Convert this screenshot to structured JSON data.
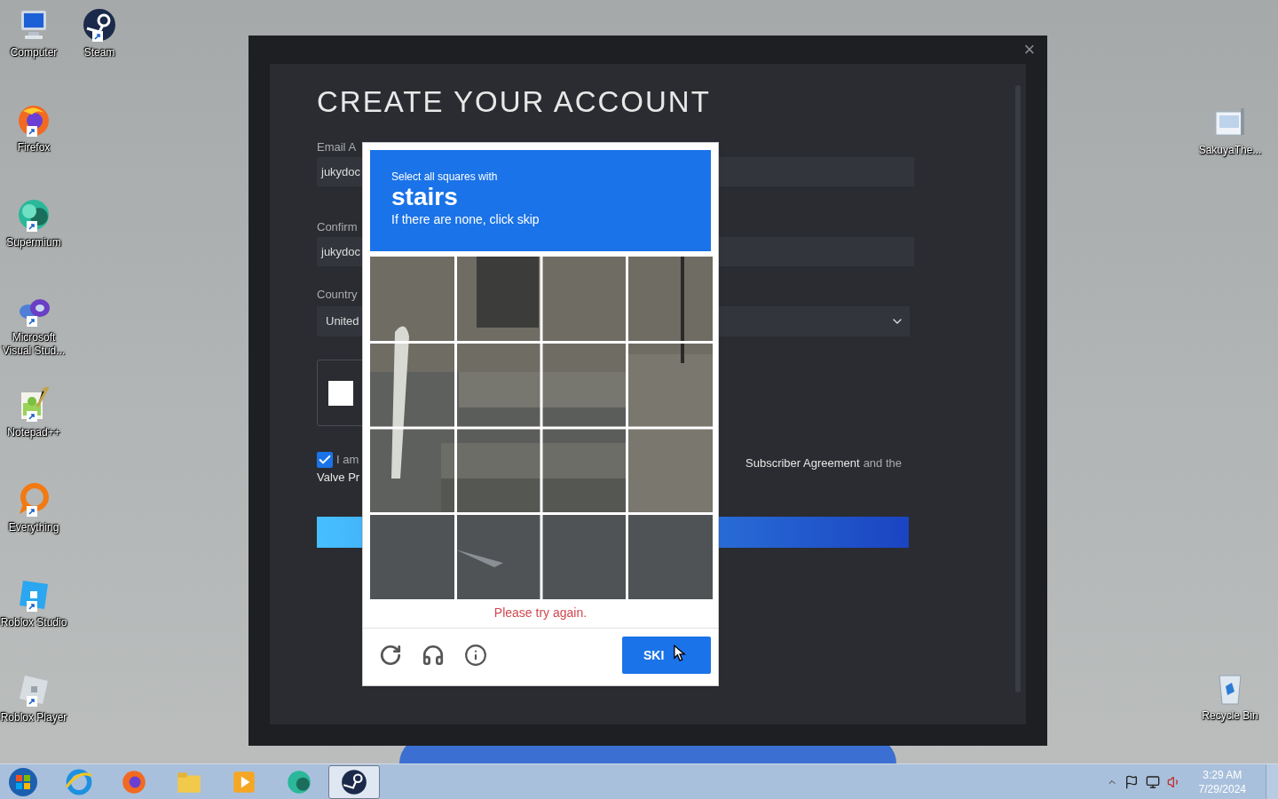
{
  "desktop_icons_left": [
    {
      "label": "Computer"
    },
    {
      "label": "Steam"
    },
    {
      "label": "Firefox"
    },
    {
      "label": "Supermium"
    },
    {
      "label": "Microsoft Visual Stud..."
    },
    {
      "label": "Notepad++"
    },
    {
      "label": "Everything"
    },
    {
      "label": "Roblox Studio"
    },
    {
      "label": "Roblox Player"
    }
  ],
  "desktop_icons_right": [
    {
      "label": "SakuyaThe..."
    },
    {
      "label": "Recycle Bin"
    }
  ],
  "dialog": {
    "close": "×",
    "title": "CREATE YOUR ACCOUNT",
    "fields": [
      {
        "label": "Email A",
        "value": "jukydoc"
      },
      {
        "label": "Confirm",
        "value": "jukydoc"
      }
    ],
    "country": {
      "label": "Country",
      "value": "United"
    },
    "robot_check": {
      "checked": false
    },
    "agreement": {
      "checked": true,
      "text_start": "I am",
      "link": "Subscriber Agreement",
      "text_end": "and the",
      "line2": "Valve Pr"
    }
  },
  "captcha": {
    "prompt": "Select all squares with",
    "target": "stairs",
    "hint": "If there are none, click skip",
    "error": "Please try again.",
    "skip": "SKI"
  },
  "taskbar": {
    "items": [
      {
        "selected": false
      },
      {
        "selected": false
      },
      {
        "selected": false
      },
      {
        "selected": false
      },
      {
        "selected": false
      },
      {
        "selected": true
      }
    ],
    "time": "3:29 AM",
    "date": "7/29/2024"
  }
}
